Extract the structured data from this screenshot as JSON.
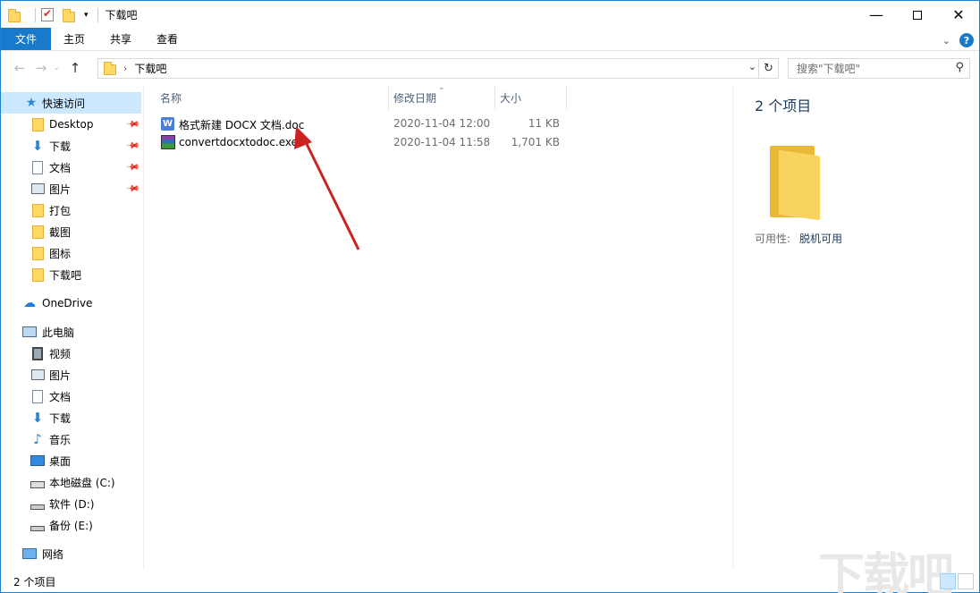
{
  "window": {
    "title": "下载吧",
    "controls": [
      "minimize",
      "maximize",
      "close"
    ]
  },
  "ribbon": {
    "tabs": [
      "文件",
      "主页",
      "共享",
      "查看"
    ]
  },
  "address": {
    "breadcrumb": "下载吧",
    "search_placeholder": "搜索\"下载吧\""
  },
  "sidebar": {
    "quick_access": "快速访问",
    "quick_items": [
      {
        "label": "Desktop",
        "icon": "folder-blue-icon",
        "pinned": true
      },
      {
        "label": "下载",
        "icon": "download-arrow-icon",
        "pinned": true
      },
      {
        "label": "文档",
        "icon": "document-icon",
        "pinned": true
      },
      {
        "label": "图片",
        "icon": "picture-icon",
        "pinned": true
      },
      {
        "label": "打包",
        "icon": "folder-icon",
        "pinned": false
      },
      {
        "label": "截图",
        "icon": "folder-icon",
        "pinned": false
      },
      {
        "label": "图标",
        "icon": "folder-icon",
        "pinned": false
      },
      {
        "label": "下载吧",
        "icon": "folder-icon",
        "pinned": false
      }
    ],
    "onedrive": "OneDrive",
    "this_pc": "此电脑",
    "pc_items": [
      {
        "label": "视频",
        "icon": "video-icon"
      },
      {
        "label": "图片",
        "icon": "picture-icon"
      },
      {
        "label": "文档",
        "icon": "document-icon"
      },
      {
        "label": "下载",
        "icon": "download-arrow-icon"
      },
      {
        "label": "音乐",
        "icon": "music-note-icon"
      },
      {
        "label": "桌面",
        "icon": "desktop-icon"
      },
      {
        "label": "本地磁盘 (C:)",
        "icon": "windows-drive-icon"
      },
      {
        "label": "软件 (D:)",
        "icon": "drive-icon"
      },
      {
        "label": "备份 (E:)",
        "icon": "drive-icon"
      }
    ],
    "network": "网络"
  },
  "columns": {
    "name": "名称",
    "date": "修改日期",
    "size": "大小"
  },
  "files": [
    {
      "name": "格式新建 DOCX 文档.doc",
      "date": "2020-11-04 12:00",
      "size": "11 KB",
      "icon": "wps-document-icon"
    },
    {
      "name": "convertdocxtodoc.exe",
      "date": "2020-11-04 11:58",
      "size": "1,701 KB",
      "icon": "winrar-archive-icon"
    }
  ],
  "details": {
    "count": "2 个项目",
    "availability_label": "可用性:",
    "availability_value": "脱机可用"
  },
  "status": {
    "count": "2 个项目"
  },
  "colors": {
    "accent": "#1979ca",
    "selection": "#cce8ff",
    "arrow": "#cc2222"
  }
}
